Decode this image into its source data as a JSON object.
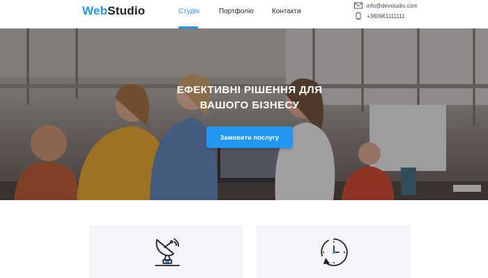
{
  "header": {
    "logo": {
      "part1": "Web",
      "part2": "Studio"
    },
    "nav": [
      {
        "label": "Студія",
        "active": true
      },
      {
        "label": "Портфоліо",
        "active": false
      },
      {
        "label": "Контакти",
        "active": false
      }
    ],
    "contacts": {
      "email": "info@devstudio.com",
      "phone": "+380961111111",
      "email_icon": "envelope-icon",
      "phone_icon": "smartphone-icon"
    }
  },
  "hero": {
    "title_line1": "ЕФЕКТИВНІ РІШЕННЯ ДЛЯ",
    "title_line2": "ВАШОГО БІЗНЕСУ",
    "button_label": "Замовити послугу"
  },
  "features": [
    {
      "icon": "satellite-dish-icon"
    },
    {
      "icon": "clock-rotate-icon"
    }
  ],
  "colors": {
    "accent": "#2196f3",
    "text": "#212121",
    "card_bg": "#f5f4fa"
  }
}
